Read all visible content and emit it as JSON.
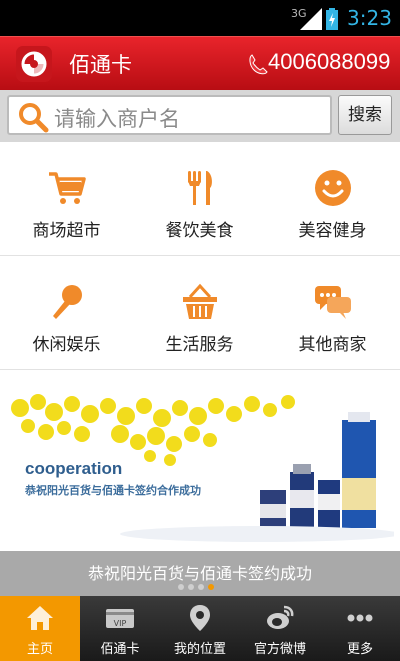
{
  "status_bar": {
    "network": "3G",
    "time": "3:23"
  },
  "header": {
    "app_title": "佰通卡",
    "phone_number": "4006088099"
  },
  "search": {
    "placeholder": "请输入商户名",
    "button_label": "搜索"
  },
  "categories": [
    {
      "label": "商场超市",
      "icon": "shopping-cart-icon"
    },
    {
      "label": "餐饮美食",
      "icon": "fork-knife-icon"
    },
    {
      "label": "美容健身",
      "icon": "smiley-face-icon"
    },
    {
      "label": "休闲娱乐",
      "icon": "microphone-icon"
    },
    {
      "label": "生活服务",
      "icon": "basket-icon"
    },
    {
      "label": "其他商家",
      "icon": "chat-bubbles-icon"
    }
  ],
  "banner": {
    "heading": "cooperation",
    "subheading": "恭祝阳光百货与佰通卡签约合作成功",
    "caption": "恭祝阳光百货与佰通卡签约成功",
    "slide_count": 4,
    "active_slide": 4
  },
  "tabs": [
    {
      "label": "主页",
      "icon": "home-icon",
      "active": true
    },
    {
      "label": "佰通卡",
      "icon": "vip-card-icon",
      "badge": "VIP",
      "active": false
    },
    {
      "label": "我的位置",
      "icon": "location-pin-icon",
      "active": false
    },
    {
      "label": "官方微博",
      "icon": "weibo-icon",
      "active": false
    },
    {
      "label": "更多",
      "icon": "more-dots-icon",
      "active": false
    }
  ],
  "colors": {
    "header_red": "#d8141b",
    "accent_orange": "#f39800",
    "status_blue": "#33b5e5"
  }
}
